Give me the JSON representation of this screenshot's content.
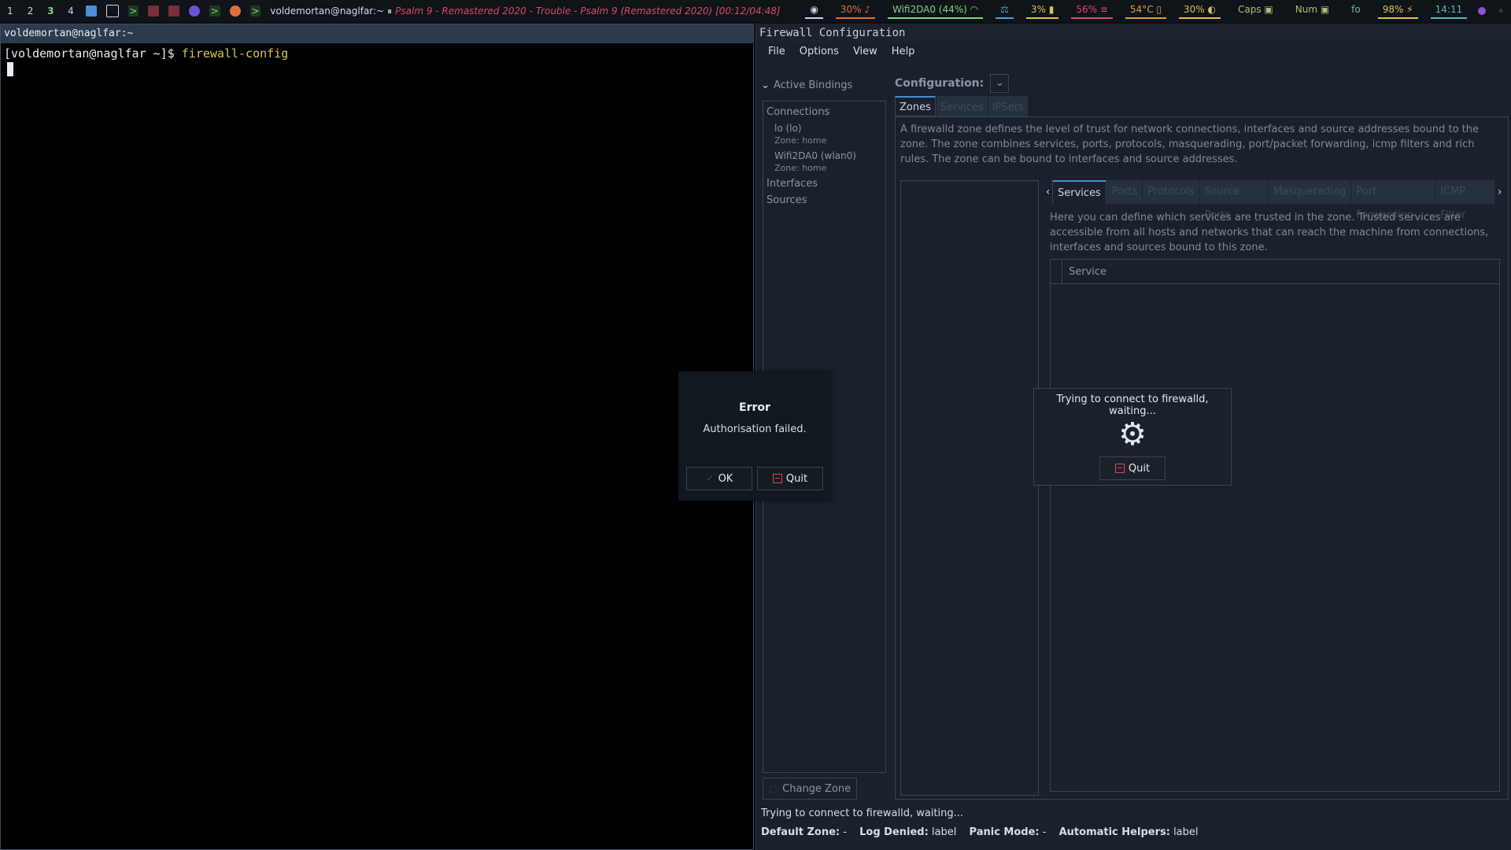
{
  "topbar": {
    "workspaces": [
      "1",
      "2",
      "3",
      "4"
    ],
    "active_workspace": "3",
    "window_title": "voldemortan@naglfar:~",
    "media": "Psalm 9 - Remastered 2020 - Trouble - Psalm 9 (Remastered 2020) [00:12/04:48]",
    "stats": {
      "volume": "30%",
      "wifi": "Wifi2DA0 (44%)",
      "cpu": "3%",
      "mem": "56%",
      "temp": "54°C",
      "brightness": "30%",
      "caps": "Caps",
      "num": "Num",
      "layout": "fo",
      "battery": "98%",
      "clock": "14:11"
    }
  },
  "terminal": {
    "title": "voldemortan@naglfar:~",
    "prompt": "[voldemortan@naglfar ~]$ ",
    "command": "firewall-config"
  },
  "firewall": {
    "title": "Firewall Configuration",
    "menu": [
      "File",
      "Options",
      "View",
      "Help"
    ],
    "active_bindings_label": "Active Bindings",
    "connections_label": "Connections",
    "connections": [
      {
        "name": "lo (lo)",
        "zone": "Zone: home"
      },
      {
        "name": "Wifi2DA0 (wlan0)",
        "zone": "Zone: home"
      }
    ],
    "interfaces_label": "Interfaces",
    "sources_label": "Sources",
    "change_zone_label": "Change Zone",
    "configuration_label": "Configuration:",
    "main_tabs": [
      "Zones",
      "Services",
      "IPSets"
    ],
    "zone_description": "A firewalld zone defines the level of trust for network connections, interfaces and source addresses bound to the zone. The zone combines services, ports, protocols, masquerading, port/packet forwarding, icmp filters and rich rules. The zone can be bound to interfaces and source addresses.",
    "sub_tabs": [
      "Services",
      "Ports",
      "Protocols",
      "Source Ports",
      "Masquerading",
      "Port Forwarding",
      "ICMP Filter"
    ],
    "services_description": "Here you can define which services are trusted in the zone. Trusted services are accessible from all hosts and networks that can reach the machine from connections, interfaces and sources bound to this zone.",
    "service_column": "Service",
    "status_line": "Trying to connect to firewalld, waiting...",
    "status_bar": {
      "default_zone_label": "Default Zone:",
      "default_zone_value": "-",
      "log_denied_label": "Log Denied:",
      "log_denied_value": "label",
      "panic_mode_label": "Panic Mode:",
      "panic_mode_value": "-",
      "auto_helpers_label": "Automatic Helpers:",
      "auto_helpers_value": "label"
    }
  },
  "connecting_dialog": {
    "message": "Trying to connect to firewalld, waiting...",
    "quit_label": "Quit",
    "icon": "gear-icon"
  },
  "error_dialog": {
    "title": "Error",
    "message": "Authorisation failed.",
    "ok_label": "OK",
    "quit_label": "Quit"
  },
  "colors": {
    "accent": "#3f8fd2",
    "prompt_cmd": "#d8c25a",
    "media": "#d84a6b",
    "quit_icon": "#e0405a"
  }
}
